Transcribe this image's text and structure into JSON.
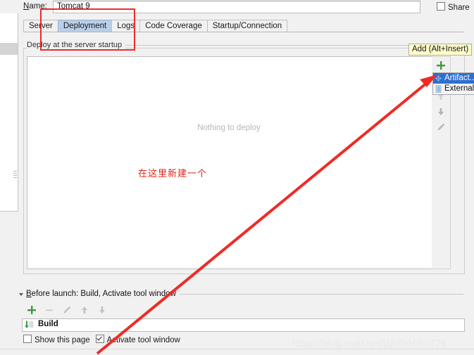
{
  "window": {
    "name_label": "Name:",
    "name_value": "Tomcat 9",
    "share_label": "Share"
  },
  "tabs": [
    {
      "label": "Server",
      "selected": false
    },
    {
      "label": "Deployment",
      "selected": true
    },
    {
      "label": "Logs",
      "selected": false
    },
    {
      "label": "Code Coverage",
      "selected": false
    },
    {
      "label": "Startup/Connection",
      "selected": false
    }
  ],
  "deployment": {
    "group_title": "Deploy at the server startup",
    "empty_text": "Nothing to deploy",
    "annotation_cn": "在这里新建一个",
    "toolbar": [
      {
        "name": "add-icon",
        "label": "Add"
      },
      {
        "name": "remove-icon",
        "label": "Remove"
      },
      {
        "name": "move-up-icon",
        "label": "Move Up"
      },
      {
        "name": "move-down-icon",
        "label": "Move Down"
      },
      {
        "name": "edit-icon",
        "label": "Edit"
      }
    ]
  },
  "tooltip": {
    "text": "Add (Alt+Insert)"
  },
  "add_menu": {
    "items": [
      {
        "label": "Artifact...",
        "icon": "artifact-icon",
        "selected": true
      },
      {
        "label": "External...",
        "icon": "external-source-icon",
        "selected": false
      }
    ]
  },
  "before_launch": {
    "title": "Before launch: Build, Activate tool window",
    "toolbar": [
      {
        "name": "add-icon",
        "label": "Add"
      },
      {
        "name": "remove-icon",
        "label": "Remove"
      },
      {
        "name": "edit-icon",
        "label": "Edit"
      },
      {
        "name": "move-up-icon",
        "label": "Move Up"
      },
      {
        "name": "move-down-icon",
        "label": "Move Down"
      }
    ],
    "rows": [
      {
        "label": "Build",
        "icon": "build-icon"
      }
    ]
  },
  "bottom_options": {
    "show_page_label": "Show this page",
    "show_page_checked": false,
    "activate_tool_window_label": "Activate tool window",
    "activate_tool_window_checked": true
  },
  "watermark": {
    "line1": "https://blog.csdn.net/j18791050779",
    "line2": "https://blog.csdn.net/j18791050779"
  },
  "colors": {
    "accent_selection": "#2f6fd0",
    "tab_selected": "#b9cfe9",
    "annotation_red": "#ef2b25",
    "tooltip_bg": "#ffffcc",
    "add_green": "#3c9c3c"
  }
}
